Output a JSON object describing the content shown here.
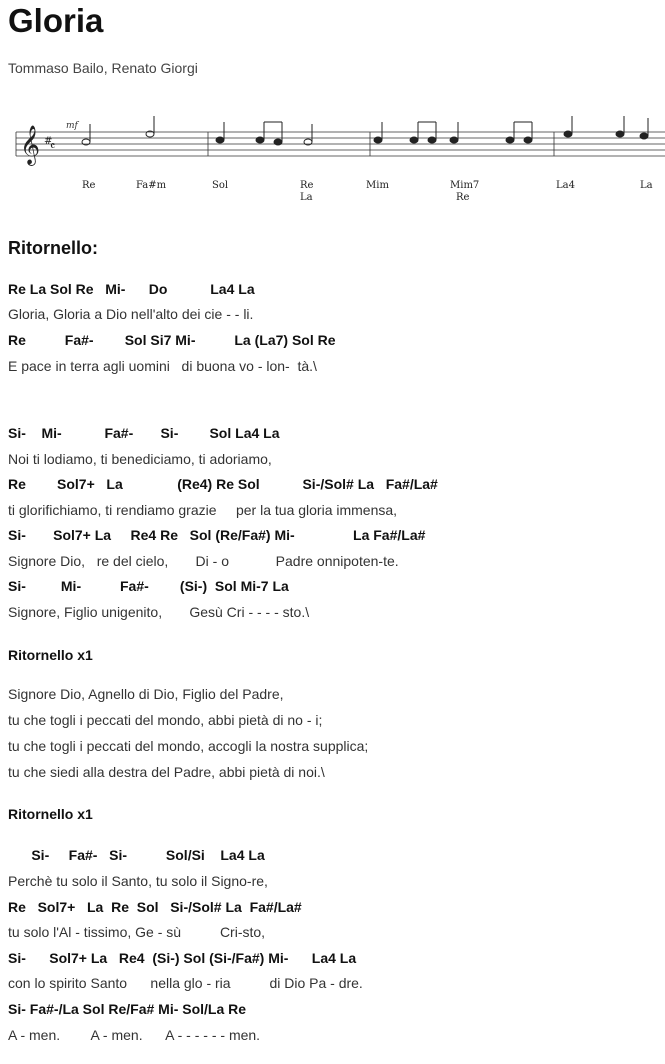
{
  "song": {
    "title": "Gloria",
    "authors": "Tommaso Bailo, Renato Giorgi"
  },
  "staff": {
    "tempo_marking": "mf",
    "chords": [
      "Re",
      "Fa#m",
      "Sol",
      "Re",
      "La",
      "Mim",
      "Mim7",
      "Re",
      "La4",
      "La"
    ]
  },
  "sections": {
    "ritornello_heading": "Ritornello:",
    "ritornello_x1_a": "Ritornello x1",
    "ritornello_x1_b": "Ritornello x1"
  },
  "lines": [
    "Re La Sol Re   Mi-      Do           La4 La",
    "Gloria, Gloria a Dio nell'alto dei cie - - li.",
    "Re          Fa#-        Sol Si7 Mi-          La (La7) Sol Re",
    "E pace in terra agli uomini   di buona vo - lon-  tà.\\",
    "Si-    Mi-           Fa#-       Si-        Sol La4 La",
    "Noi ti lodiamo, ti benediciamo, ti adoriamo,",
    "Re        Sol7+   La              (Re4) Re Sol           Si-/Sol# La   Fa#/La#",
    "ti glorifichiamo, ti rendiamo grazie     per la tua gloria immensa,",
    "Si-       Sol7+ La     Re4 Re   Sol (Re/Fa#) Mi-               La Fa#/La#",
    "Signore Dio,   re del cielo,       Di - o            Padre onnipoten-te.",
    "Si-         Mi-          Fa#-        (Si-)  Sol Mi-7 La",
    "Signore, Figlio unigenito,       Gesù Cri - - - - sto.\\",
    "Signore Dio, Agnello di Dio, Figlio del Padre,",
    "tu che togli i peccati del mondo, abbi pietà di no - i;",
    "tu che togli i peccati del mondo, accogli la nostra supplica;",
    "tu che siedi alla destra del Padre, abbi pietà di noi.\\",
    "      Si-     Fa#-   Si-          Sol/Si    La4 La",
    "Perchè tu solo il Santo, tu solo il Signo-re,",
    "Re   Sol7+   La  Re  Sol   Si-/Sol# La  Fa#/La#",
    "tu solo l'Al - tissimo, Ge - sù          Cri-sto,",
    "Si-      Sol7+ La   Re4  (Si-) Sol (Si-/Fa#) Mi-      La4 La",
    "con lo spirito Santo      nella glo - ria          di Dio Pa - dre.",
    "Si- Fa#-/La Sol Re/Fa# Mi- Sol/La Re",
    "A - men.        A - men.      A - - - - - - men."
  ]
}
